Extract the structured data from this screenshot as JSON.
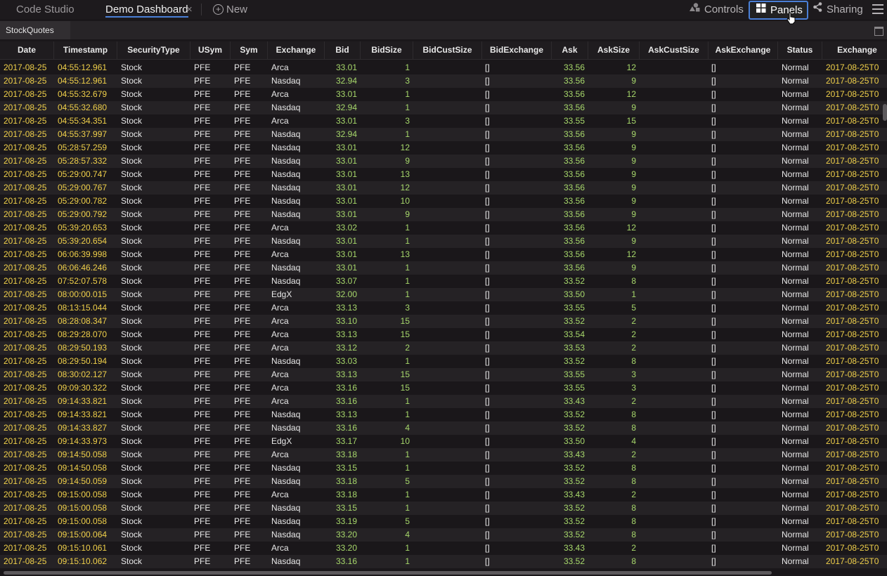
{
  "topbar": {
    "app_tab": "Code Studio",
    "active_tab": "Demo Dashboard",
    "close_glyph": "×",
    "new_label": "New",
    "controls_label": "Controls",
    "panels_label": "Panels",
    "sharing_label": "Sharing",
    "accent_color": "#4a7fd6"
  },
  "panel": {
    "title": "StockQuotes"
  },
  "table": {
    "columns": [
      "Date",
      "Timestamp",
      "SecurityType",
      "USym",
      "Sym",
      "Exchange",
      "Bid",
      "BidSize",
      "BidCustSize",
      "BidExchange",
      "Ask",
      "AskSize",
      "AskCustSize",
      "AskExchange",
      "Status",
      "Exchange"
    ],
    "colors": {
      "date": "#f0d04a",
      "number": "#a7d86b",
      "text": "#e8e8e8"
    },
    "rows": [
      [
        "2017-08-25",
        "04:55:12.961",
        "Stock",
        "PFE",
        "PFE",
        "Arca",
        "33.01",
        "1",
        "[]",
        "33.56",
        "12",
        "[]",
        "Normal",
        "2017-08-25T0"
      ],
      [
        "2017-08-25",
        "04:55:12.961",
        "Stock",
        "PFE",
        "PFE",
        "Nasdaq",
        "32.94",
        "3",
        "[]",
        "33.56",
        "9",
        "[]",
        "Normal",
        "2017-08-25T0"
      ],
      [
        "2017-08-25",
        "04:55:32.679",
        "Stock",
        "PFE",
        "PFE",
        "Arca",
        "33.01",
        "1",
        "[]",
        "33.56",
        "12",
        "[]",
        "Normal",
        "2017-08-25T0"
      ],
      [
        "2017-08-25",
        "04:55:32.680",
        "Stock",
        "PFE",
        "PFE",
        "Nasdaq",
        "32.94",
        "1",
        "[]",
        "33.56",
        "9",
        "[]",
        "Normal",
        "2017-08-25T0"
      ],
      [
        "2017-08-25",
        "04:55:34.351",
        "Stock",
        "PFE",
        "PFE",
        "Arca",
        "33.01",
        "3",
        "[]",
        "33.55",
        "15",
        "[]",
        "Normal",
        "2017-08-25T0"
      ],
      [
        "2017-08-25",
        "04:55:37.997",
        "Stock",
        "PFE",
        "PFE",
        "Nasdaq",
        "32.94",
        "1",
        "[]",
        "33.56",
        "9",
        "[]",
        "Normal",
        "2017-08-25T0"
      ],
      [
        "2017-08-25",
        "05:28:57.259",
        "Stock",
        "PFE",
        "PFE",
        "Nasdaq",
        "33.01",
        "12",
        "[]",
        "33.56",
        "9",
        "[]",
        "Normal",
        "2017-08-25T0"
      ],
      [
        "2017-08-25",
        "05:28:57.332",
        "Stock",
        "PFE",
        "PFE",
        "Nasdaq",
        "33.01",
        "9",
        "[]",
        "33.56",
        "9",
        "[]",
        "Normal",
        "2017-08-25T0"
      ],
      [
        "2017-08-25",
        "05:29:00.747",
        "Stock",
        "PFE",
        "PFE",
        "Nasdaq",
        "33.01",
        "13",
        "[]",
        "33.56",
        "9",
        "[]",
        "Normal",
        "2017-08-25T0"
      ],
      [
        "2017-08-25",
        "05:29:00.767",
        "Stock",
        "PFE",
        "PFE",
        "Nasdaq",
        "33.01",
        "12",
        "[]",
        "33.56",
        "9",
        "[]",
        "Normal",
        "2017-08-25T0"
      ],
      [
        "2017-08-25",
        "05:29:00.782",
        "Stock",
        "PFE",
        "PFE",
        "Nasdaq",
        "33.01",
        "10",
        "[]",
        "33.56",
        "9",
        "[]",
        "Normal",
        "2017-08-25T0"
      ],
      [
        "2017-08-25",
        "05:29:00.792",
        "Stock",
        "PFE",
        "PFE",
        "Nasdaq",
        "33.01",
        "9",
        "[]",
        "33.56",
        "9",
        "[]",
        "Normal",
        "2017-08-25T0"
      ],
      [
        "2017-08-25",
        "05:39:20.653",
        "Stock",
        "PFE",
        "PFE",
        "Arca",
        "33.02",
        "1",
        "[]",
        "33.56",
        "12",
        "[]",
        "Normal",
        "2017-08-25T0"
      ],
      [
        "2017-08-25",
        "05:39:20.654",
        "Stock",
        "PFE",
        "PFE",
        "Nasdaq",
        "33.01",
        "1",
        "[]",
        "33.56",
        "9",
        "[]",
        "Normal",
        "2017-08-25T0"
      ],
      [
        "2017-08-25",
        "06:06:39.998",
        "Stock",
        "PFE",
        "PFE",
        "Arca",
        "33.01",
        "13",
        "[]",
        "33.56",
        "12",
        "[]",
        "Normal",
        "2017-08-25T0"
      ],
      [
        "2017-08-25",
        "06:06:46.246",
        "Stock",
        "PFE",
        "PFE",
        "Nasdaq",
        "33.01",
        "1",
        "[]",
        "33.56",
        "9",
        "[]",
        "Normal",
        "2017-08-25T0"
      ],
      [
        "2017-08-25",
        "07:52:07.578",
        "Stock",
        "PFE",
        "PFE",
        "Nasdaq",
        "33.07",
        "1",
        "[]",
        "33.52",
        "8",
        "[]",
        "Normal",
        "2017-08-25T0"
      ],
      [
        "2017-08-25",
        "08:00:00.015",
        "Stock",
        "PFE",
        "PFE",
        "EdgX",
        "32.00",
        "1",
        "[]",
        "33.50",
        "1",
        "[]",
        "Normal",
        "2017-08-25T0"
      ],
      [
        "2017-08-25",
        "08:13:15.044",
        "Stock",
        "PFE",
        "PFE",
        "Arca",
        "33.13",
        "3",
        "[]",
        "33.55",
        "5",
        "[]",
        "Normal",
        "2017-08-25T0"
      ],
      [
        "2017-08-25",
        "08:28:08.347",
        "Stock",
        "PFE",
        "PFE",
        "Arca",
        "33.10",
        "15",
        "[]",
        "33.52",
        "2",
        "[]",
        "Normal",
        "2017-08-25T0"
      ],
      [
        "2017-08-25",
        "08:29:28.070",
        "Stock",
        "PFE",
        "PFE",
        "Arca",
        "33.13",
        "15",
        "[]",
        "33.54",
        "2",
        "[]",
        "Normal",
        "2017-08-25T0"
      ],
      [
        "2017-08-25",
        "08:29:50.193",
        "Stock",
        "PFE",
        "PFE",
        "Arca",
        "33.12",
        "2",
        "[]",
        "33.53",
        "2",
        "[]",
        "Normal",
        "2017-08-25T0"
      ],
      [
        "2017-08-25",
        "08:29:50.194",
        "Stock",
        "PFE",
        "PFE",
        "Nasdaq",
        "33.03",
        "1",
        "[]",
        "33.52",
        "8",
        "[]",
        "Normal",
        "2017-08-25T0"
      ],
      [
        "2017-08-25",
        "08:30:02.127",
        "Stock",
        "PFE",
        "PFE",
        "Arca",
        "33.13",
        "15",
        "[]",
        "33.55",
        "3",
        "[]",
        "Normal",
        "2017-08-25T0"
      ],
      [
        "2017-08-25",
        "09:09:30.322",
        "Stock",
        "PFE",
        "PFE",
        "Arca",
        "33.16",
        "15",
        "[]",
        "33.55",
        "3",
        "[]",
        "Normal",
        "2017-08-25T0"
      ],
      [
        "2017-08-25",
        "09:14:33.821",
        "Stock",
        "PFE",
        "PFE",
        "Arca",
        "33.16",
        "1",
        "[]",
        "33.43",
        "2",
        "[]",
        "Normal",
        "2017-08-25T0"
      ],
      [
        "2017-08-25",
        "09:14:33.821",
        "Stock",
        "PFE",
        "PFE",
        "Nasdaq",
        "33.13",
        "1",
        "[]",
        "33.52",
        "8",
        "[]",
        "Normal",
        "2017-08-25T0"
      ],
      [
        "2017-08-25",
        "09:14:33.827",
        "Stock",
        "PFE",
        "PFE",
        "Nasdaq",
        "33.16",
        "4",
        "[]",
        "33.52",
        "8",
        "[]",
        "Normal",
        "2017-08-25T0"
      ],
      [
        "2017-08-25",
        "09:14:33.973",
        "Stock",
        "PFE",
        "PFE",
        "EdgX",
        "33.17",
        "10",
        "[]",
        "33.50",
        "4",
        "[]",
        "Normal",
        "2017-08-25T0"
      ],
      [
        "2017-08-25",
        "09:14:50.058",
        "Stock",
        "PFE",
        "PFE",
        "Arca",
        "33.18",
        "1",
        "[]",
        "33.43",
        "2",
        "[]",
        "Normal",
        "2017-08-25T0"
      ],
      [
        "2017-08-25",
        "09:14:50.058",
        "Stock",
        "PFE",
        "PFE",
        "Nasdaq",
        "33.15",
        "1",
        "[]",
        "33.52",
        "8",
        "[]",
        "Normal",
        "2017-08-25T0"
      ],
      [
        "2017-08-25",
        "09:14:50.059",
        "Stock",
        "PFE",
        "PFE",
        "Nasdaq",
        "33.18",
        "5",
        "[]",
        "33.52",
        "8",
        "[]",
        "Normal",
        "2017-08-25T0"
      ],
      [
        "2017-08-25",
        "09:15:00.058",
        "Stock",
        "PFE",
        "PFE",
        "Arca",
        "33.18",
        "1",
        "[]",
        "33.43",
        "2",
        "[]",
        "Normal",
        "2017-08-25T0"
      ],
      [
        "2017-08-25",
        "09:15:00.058",
        "Stock",
        "PFE",
        "PFE",
        "Nasdaq",
        "33.15",
        "1",
        "[]",
        "33.52",
        "8",
        "[]",
        "Normal",
        "2017-08-25T0"
      ],
      [
        "2017-08-25",
        "09:15:00.058",
        "Stock",
        "PFE",
        "PFE",
        "Nasdaq",
        "33.19",
        "5",
        "[]",
        "33.52",
        "8",
        "[]",
        "Normal",
        "2017-08-25T0"
      ],
      [
        "2017-08-25",
        "09:15:00.064",
        "Stock",
        "PFE",
        "PFE",
        "Nasdaq",
        "33.20",
        "4",
        "[]",
        "33.52",
        "8",
        "[]",
        "Normal",
        "2017-08-25T0"
      ],
      [
        "2017-08-25",
        "09:15:10.061",
        "Stock",
        "PFE",
        "PFE",
        "Arca",
        "33.20",
        "1",
        "[]",
        "33.43",
        "2",
        "[]",
        "Normal",
        "2017-08-25T0"
      ],
      [
        "2017-08-25",
        "09:15:10.062",
        "Stock",
        "PFE",
        "PFE",
        "Nasdaq",
        "33.16",
        "1",
        "[]",
        "33.52",
        "8",
        "[]",
        "Normal",
        "2017-08-25T0"
      ]
    ]
  }
}
